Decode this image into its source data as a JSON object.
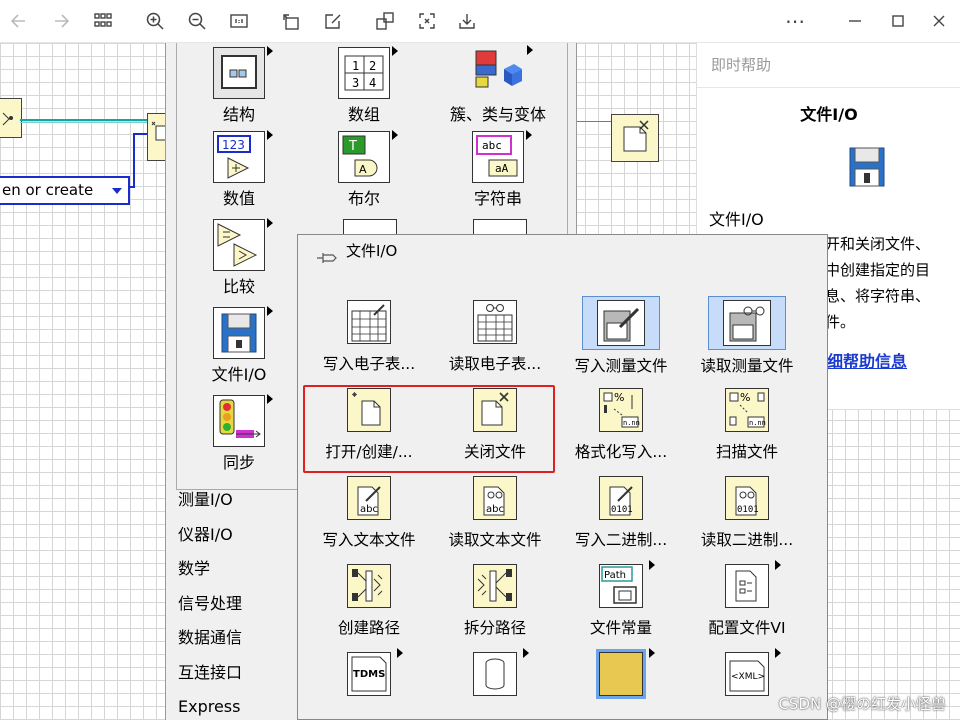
{
  "toolbar": {
    "buttons": [
      "back-icon",
      "forward-icon",
      "grid-icon",
      "zoom-in-icon",
      "zoom-out-icon",
      "fit-icon",
      "rotate-icon",
      "edit-icon",
      "crop-icon",
      "fullscreen-icon",
      "download-icon",
      "more-icon",
      "minimize-icon",
      "maximize-icon",
      "close-icon"
    ]
  },
  "canvas": {
    "control_text": "en or create"
  },
  "palette": {
    "items": [
      {
        "label": "结构"
      },
      {
        "label": "数组"
      },
      {
        "label": "簇、类与变体"
      },
      {
        "label": "数值"
      },
      {
        "label": "布尔"
      },
      {
        "label": "字符串"
      },
      {
        "label": "比较"
      },
      {
        "label": "文件I/O"
      },
      {
        "label": "同步"
      }
    ],
    "sub_categories": [
      "测量I/O",
      "仪器I/O",
      "数学",
      "信号处理",
      "数据通信",
      "互连接口",
      "Express"
    ]
  },
  "help": {
    "header": "即时帮助",
    "title": "文件I/O",
    "label": "文件I/O",
    "text_lines": [
      "开和关闭文件、",
      "中创建指定的目",
      "息、将字符串、",
      "件。"
    ],
    "link": "细帮助信息"
  },
  "fileio": {
    "title": "文件I/O",
    "items": [
      {
        "label": "写入电子表..."
      },
      {
        "label": "读取电子表..."
      },
      {
        "label": "写入测量文件"
      },
      {
        "label": "读取测量文件"
      },
      {
        "label": "打开/创建/..."
      },
      {
        "label": "关闭文件"
      },
      {
        "label": "格式化写入..."
      },
      {
        "label": "扫描文件"
      },
      {
        "label": "写入文本文件"
      },
      {
        "label": "读取文本文件"
      },
      {
        "label": "写入二进制..."
      },
      {
        "label": "读取二进制..."
      },
      {
        "label": "创建路径"
      },
      {
        "label": "拆分路径"
      },
      {
        "label": "文件常量"
      },
      {
        "label": "配置文件VI"
      }
    ],
    "icon_text": {
      "abc": "abc",
      "bin": "0101",
      "path": "Path",
      "tdms": "TDMS",
      "xml": "<XML>",
      "n_nn": "n.nn",
      "num": "123",
      "bool": "T",
      "str": "abc"
    }
  },
  "watermark": "CSDN @樱の红发小怪兽"
}
